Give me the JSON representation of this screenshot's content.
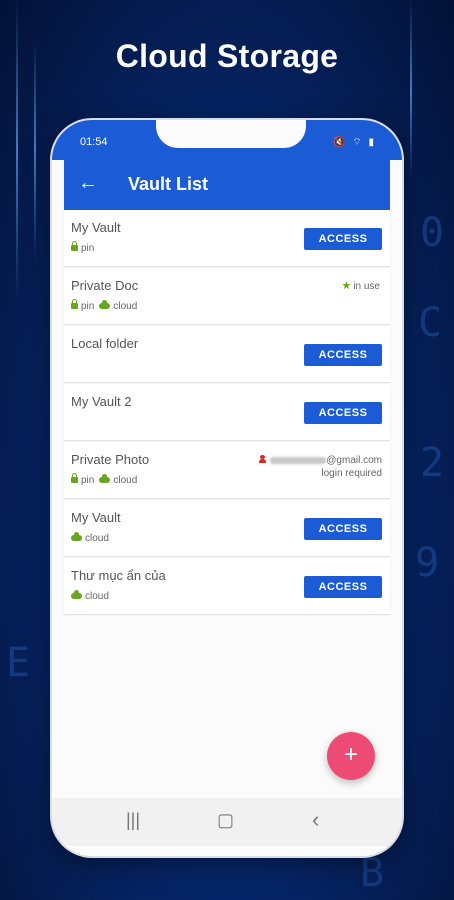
{
  "headline": "Cloud Storage",
  "status_bar": {
    "time": "01:54",
    "icons": "🔇 ⌔ ▮"
  },
  "app_bar": {
    "back_icon": "arrow-back-icon",
    "title": "Vault List"
  },
  "vaults": [
    {
      "name": "My Vault",
      "tags": [
        "pin"
      ],
      "action": "ACCESS"
    },
    {
      "name": "Private Doc",
      "tags": [
        "pin",
        "cloud"
      ],
      "status": "in use"
    },
    {
      "name": "Local folder",
      "tags": [],
      "action": "ACCESS"
    },
    {
      "name": "My Vault 2",
      "tags": [],
      "action": "ACCESS"
    },
    {
      "name": "Private Photo",
      "tags": [
        "pin",
        "cloud"
      ],
      "account": "@gmail.com",
      "account_note": "login required"
    },
    {
      "name": "My Vault",
      "tags": [
        "cloud"
      ],
      "action": "ACCESS"
    },
    {
      "name": "Thư mục ẩn của",
      "tags": [
        "cloud"
      ],
      "action": "ACCESS"
    }
  ],
  "fab_label": "+",
  "nav": {
    "recents": "|||",
    "home": "▢",
    "back": "‹"
  },
  "colors": {
    "primary": "#1b5bd6",
    "fab": "#ee4b74",
    "tag_green": "#6aa51f",
    "account_red": "#e02323"
  }
}
